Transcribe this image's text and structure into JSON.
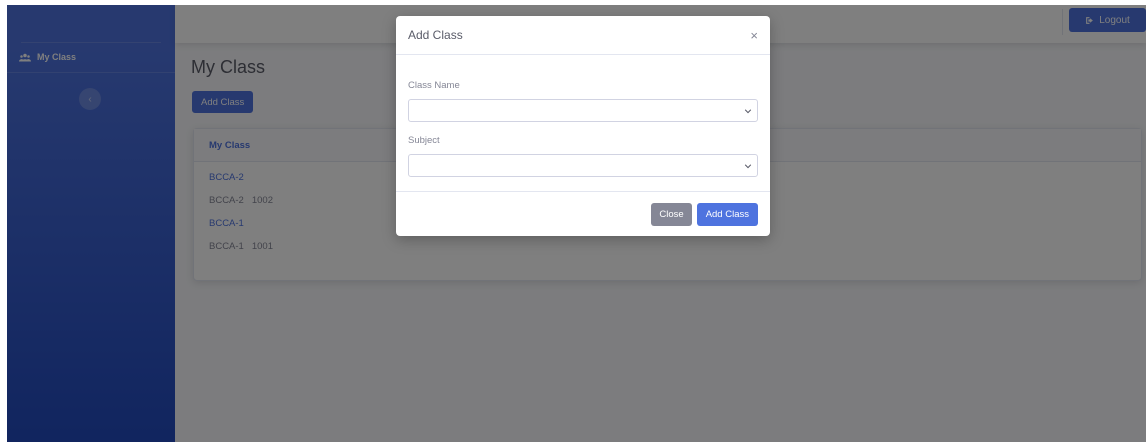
{
  "sidebar": {
    "items": [
      {
        "label": "My Class",
        "icon": "users-icon"
      }
    ],
    "toggle_icon": "‹"
  },
  "topbar": {
    "logout_label": "Logout",
    "logout_icon": "sign-out-icon"
  },
  "main": {
    "title": "My Class",
    "add_button": "Add Class",
    "card": {
      "header": "My Class",
      "rows": [
        {
          "name": "BCCA-2",
          "code": "",
          "type": "link"
        },
        {
          "name": "BCCA-2",
          "code": "1002",
          "type": "text"
        },
        {
          "name": "BCCA-1",
          "code": "",
          "type": "link"
        },
        {
          "name": "BCCA-1",
          "code": "1001",
          "type": "text"
        }
      ]
    }
  },
  "modal": {
    "title": "Add Class",
    "close_glyph": "×",
    "fields": [
      {
        "label": "Class Name",
        "value": ""
      },
      {
        "label": "Subject",
        "value": ""
      }
    ],
    "close_button": "Close",
    "submit_button": "Add Class"
  },
  "colors": {
    "primary": "#4e73df",
    "secondary": "#858796",
    "overlay": "rgba(0,0,0,0.5)"
  }
}
